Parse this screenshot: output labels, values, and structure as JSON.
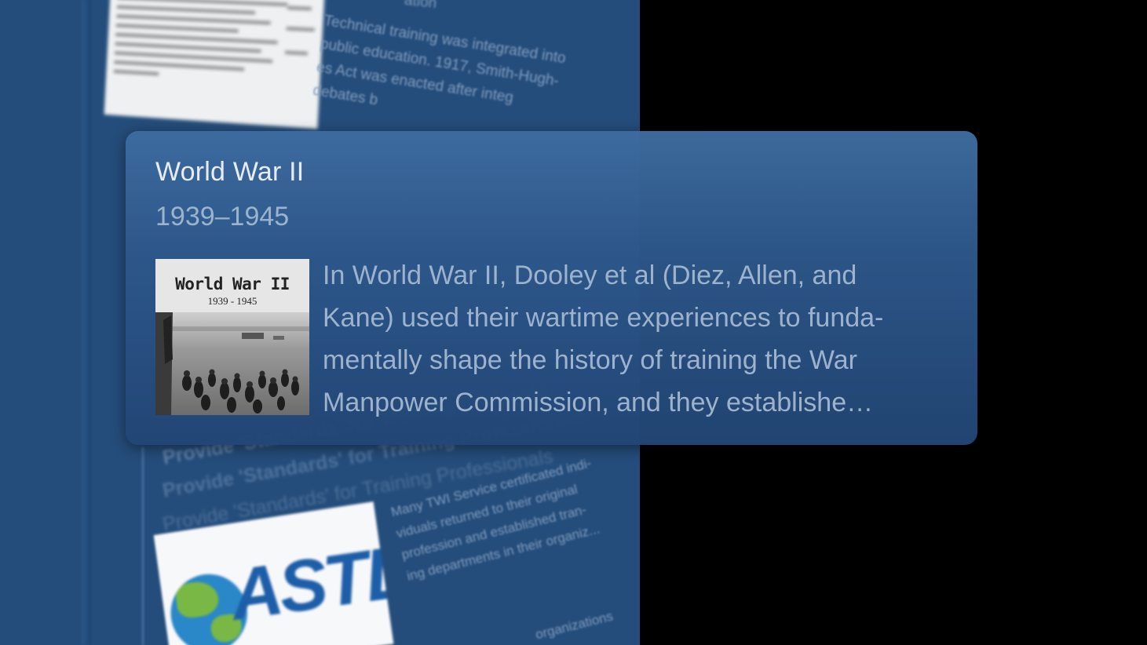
{
  "background": {
    "top_fragment": "ation",
    "top_text_lines": [
      "Technical training was integrated into",
      "public education. 1917, Smith-Hugh-",
      "es Act was enacted after integ",
      "debates b"
    ],
    "heading_faint": "Provide 'Standards' for Training Professio...",
    "heading": "Provide 'Standards' for Training Professionals",
    "heading_sub": "Provide 'Standards' for Training Professionals",
    "bottom_text_lines": [
      "Many TWI Service certificated indi-",
      "viduals returned to their original",
      "profession and established tran-",
      "ing departments in their organiz..."
    ],
    "bottom_fragment": "organizations",
    "logo_text": "ASTD"
  },
  "card": {
    "title": "World War II",
    "dates": "1939–1945",
    "thumbnail": {
      "title": "World War II",
      "subtitle": "1939 - 1945"
    },
    "body": "In World War II, Dooley et al (Diez, Allen, and Kane) used their wartime experiences to funda-mentally shape the history of training the War Manpower Commission, and they establishe…",
    "body_lines": [
      "In World War II, Dooley et al (Diez, Allen, and",
      "Kane) used their wartime experiences to funda-",
      "mentally shape the history of training the War",
      "Manpower Commission, and they establishe…"
    ]
  },
  "colors": {
    "background_panel": "#254d7b",
    "card_top": "#3e6ca0",
    "card_bottom": "#224675",
    "title_text": "#e7ecf2",
    "muted_text": "#9cb3cd"
  }
}
